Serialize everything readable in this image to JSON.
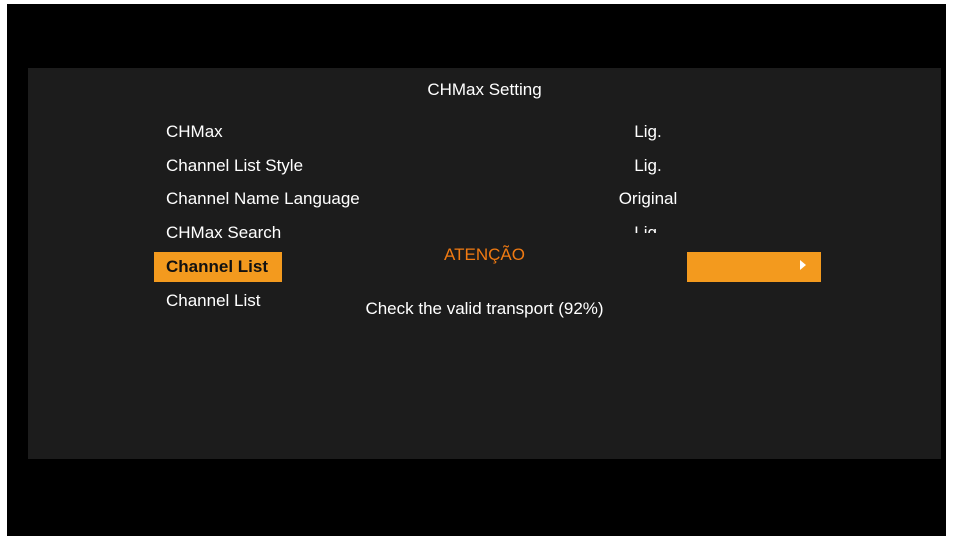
{
  "menu": {
    "title": "CHMax Setting",
    "rows": [
      {
        "label": "CHMax",
        "value": "Lig."
      },
      {
        "label": "Channel List Style",
        "value": "Lig."
      },
      {
        "label": "Channel Name Language",
        "value": "Original"
      },
      {
        "label": "CHMax Search",
        "value": "Lig."
      },
      {
        "label": "Channel List",
        "value": ""
      },
      {
        "label": "Channel List",
        "value": ""
      }
    ],
    "selected_row": 4,
    "colors": {
      "highlight": "#f39a1e",
      "panel": "#1c1c1c",
      "text": "#ffffff"
    }
  },
  "dialog": {
    "title": "ATENÇÃO",
    "message": "Check the valid transport (92%)",
    "title_color": "#f07a12"
  },
  "icons": {
    "selected_row_arrow": "play-arrow-icon"
  }
}
